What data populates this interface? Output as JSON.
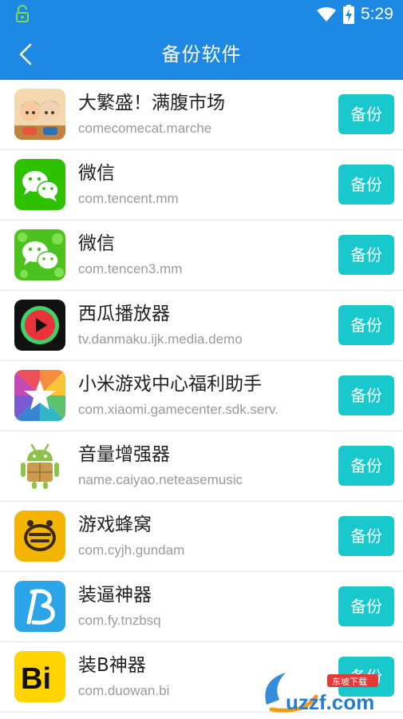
{
  "status_bar": {
    "time": "5:29",
    "icons": [
      "notification-lock-icon",
      "wifi-icon",
      "battery-charging-icon"
    ]
  },
  "app_bar": {
    "title": "备份软件",
    "back_icon": "chevron-left-icon"
  },
  "colors": {
    "primary": "#1e88e5",
    "button": "#18c8cc",
    "text": "#222222",
    "subtext": "#9a9a9a"
  },
  "apps": [
    {
      "name": "大繁盛！满腹市场",
      "package": "comecomecat.marche",
      "button": "备份",
      "icon": "game-characters-icon"
    },
    {
      "name": "微信",
      "package": "com.tencent.mm",
      "button": "备份",
      "icon": "wechat-icon"
    },
    {
      "name": "微信",
      "package": "com.tencen3.mm",
      "button": "备份",
      "icon": "wechat-clone-icon"
    },
    {
      "name": "西瓜播放器",
      "package": "tv.danmaku.ijk.media.demo",
      "button": "备份",
      "icon": "play-circle-icon"
    },
    {
      "name": "小米游戏中心福利助手",
      "package": "com.xiaomi.gamecenter.sdk.serv.",
      "button": "备份",
      "icon": "star-icon"
    },
    {
      "name": "音量增强器",
      "package": "name.caiyao.neteasemusic",
      "button": "备份",
      "icon": "android-robot-icon"
    },
    {
      "name": "游戏蜂窝",
      "package": "com.cyjh.gundam",
      "button": "备份",
      "icon": "bee-icon"
    },
    {
      "name": "装逼神器",
      "package": "com.fy.tnzbsq",
      "button": "备份",
      "icon": "letter-b-icon"
    },
    {
      "name": "装B神器",
      "package": "com.duowan.bi",
      "button": "备份",
      "icon": "bi-logo-icon"
    }
  ],
  "watermark": {
    "text": "uzzf.com",
    "subtext": "东坡下载"
  }
}
